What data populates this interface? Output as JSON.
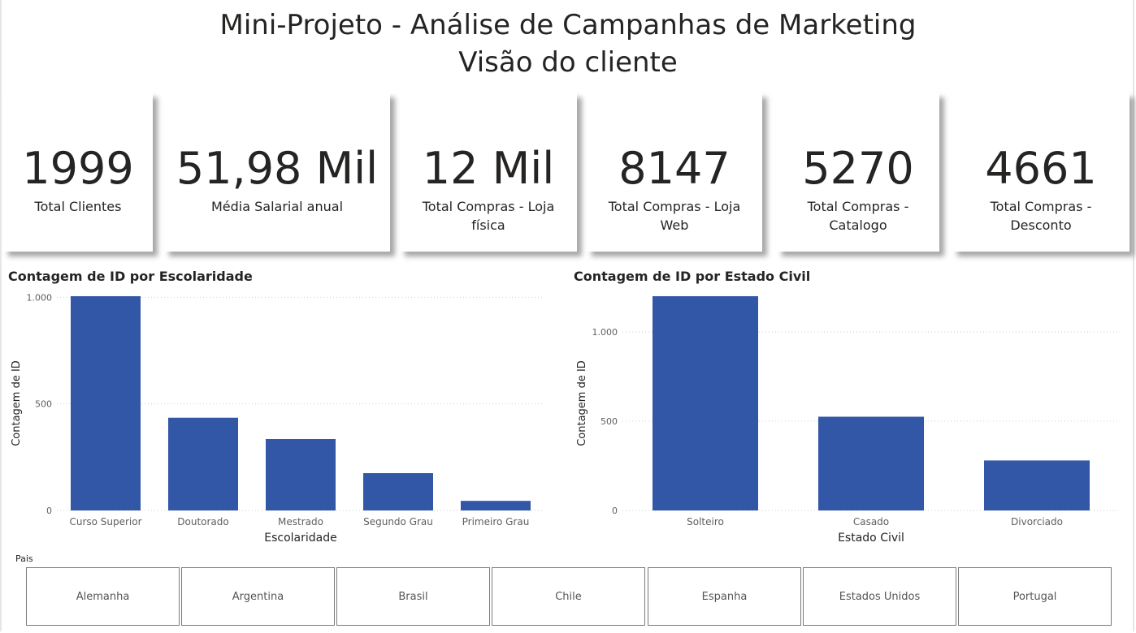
{
  "header": {
    "title_line1": "Mini-Projeto - Análise de Campanhas de Marketing",
    "title_line2": "Visão do cliente"
  },
  "kpis": [
    {
      "value": "1999",
      "label": "Total Clientes"
    },
    {
      "value": "51,98 Mil",
      "label": "Média Salarial anual"
    },
    {
      "value": "12 Mil",
      "label": "Total Compras - Loja física"
    },
    {
      "value": "8147",
      "label": "Total Compras - Loja Web"
    },
    {
      "value": "5270",
      "label": "Total Compras - Catalogo"
    },
    {
      "value": "4661",
      "label": "Total Compras - Desconto"
    }
  ],
  "chart_data": [
    {
      "type": "bar",
      "title": "Contagem de ID por Escolaridade",
      "xlabel": "Escolaridade",
      "ylabel": "Contagem de ID",
      "categories": [
        "Curso Superior",
        "Doutorado",
        "Mestrado",
        "Segundo Grau",
        "Primeiro Grau"
      ],
      "values": [
        1005,
        435,
        335,
        175,
        45
      ],
      "yticks": [
        0,
        500,
        1000
      ],
      "ytick_labels": [
        "0",
        "500",
        "1.000"
      ],
      "ylim": [
        0,
        1005
      ],
      "color": "#3357a7",
      "grid": true
    },
    {
      "type": "bar",
      "title": "Contagem de ID por Estado Civil",
      "xlabel": "Estado Civil",
      "ylabel": "Contagem de ID",
      "categories": [
        "Solteiro",
        "Casado",
        "Divorciado"
      ],
      "values": [
        1200,
        525,
        280
      ],
      "yticks": [
        0,
        500,
        1000
      ],
      "ytick_labels": [
        "0",
        "500",
        "1.000"
      ],
      "ylim": [
        0,
        1200
      ],
      "color": "#3357a7",
      "grid": true
    }
  ],
  "slicer": {
    "label": "Pais",
    "options": [
      "Alemanha",
      "Argentina",
      "Brasil",
      "Chile",
      "Espanha",
      "Estados Unidos",
      "Portugal"
    ]
  }
}
